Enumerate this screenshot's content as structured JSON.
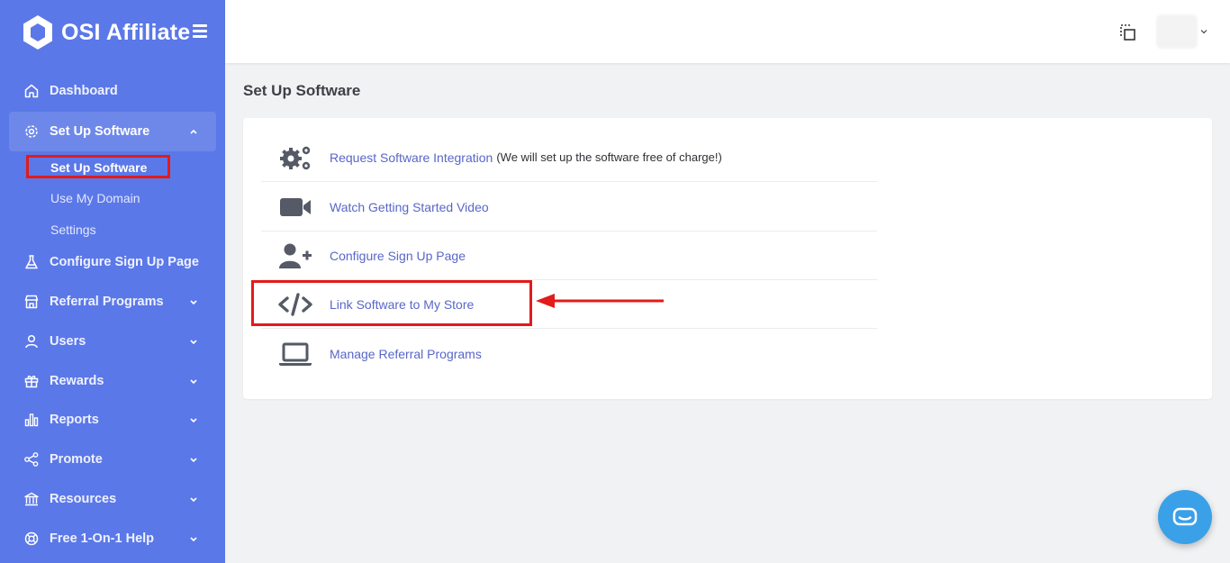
{
  "brand": {
    "name": "OSI Affiliate"
  },
  "sidebar": {
    "items": [
      {
        "label": "Dashboard",
        "icon": "home-icon"
      },
      {
        "label": "Set Up Software",
        "icon": "gear-icon",
        "expanded": true,
        "children": [
          {
            "label": "Set Up Software",
            "active": true
          },
          {
            "label": "Use My Domain"
          },
          {
            "label": "Settings"
          }
        ]
      },
      {
        "label": "Configure Sign Up Page",
        "icon": "flask-icon"
      },
      {
        "label": "Referral Programs",
        "icon": "store-icon"
      },
      {
        "label": "Users",
        "icon": "user-icon"
      },
      {
        "label": "Rewards",
        "icon": "gift-icon"
      },
      {
        "label": "Reports",
        "icon": "bar-chart-icon"
      },
      {
        "label": "Promote",
        "icon": "share-icon"
      },
      {
        "label": "Resources",
        "icon": "bank-icon"
      },
      {
        "label": "Free 1-On-1 Help",
        "icon": "lifebuoy-icon"
      }
    ]
  },
  "page": {
    "title": "Set Up Software"
  },
  "setup_list": [
    {
      "label": "Request Software Integration",
      "note": "(We will set up the software free of charge!)",
      "icon": "gears-icon"
    },
    {
      "label": "Watch Getting Started Video",
      "icon": "video-camera-icon"
    },
    {
      "label": "Configure Sign Up Page",
      "icon": "user-plus-icon"
    },
    {
      "label": "Link Software to My Store",
      "icon": "code-icon"
    },
    {
      "label": "Manage Referral Programs",
      "icon": "laptop-icon"
    }
  ],
  "colors": {
    "sidebar": "#5b78e8",
    "link": "#5867c8",
    "highlight": "#e21b1b",
    "chat": "#3aa0e8"
  }
}
